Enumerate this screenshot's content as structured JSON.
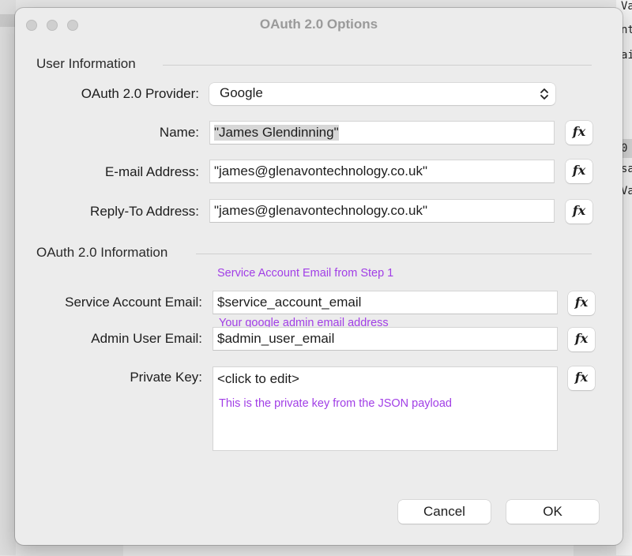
{
  "window": {
    "title": "OAuth 2.0 Options"
  },
  "sections": {
    "user_information": "User Information",
    "oauth_information": "OAuth 2.0 Information"
  },
  "fields": {
    "provider": {
      "label": "OAuth 2.0 Provider:",
      "value": "Google"
    },
    "name": {
      "label": "Name:",
      "value": "\"James Glendinning\""
    },
    "email": {
      "label": "E-mail Address:",
      "value": "\"james@glenavontechnology.co.uk\""
    },
    "reply_to": {
      "label": "Reply-To Address:",
      "value": "\"james@glenavontechnology.co.uk\""
    },
    "service_account": {
      "label": "Service Account Email:",
      "value": "$service_account_email",
      "hint": "Service Account Email from Step 1"
    },
    "admin_user": {
      "label": "Admin User Email:",
      "value": "$admin_user_email",
      "hint": "Your google admin email address"
    },
    "private_key": {
      "label": "Private Key:",
      "value": "<click to edit>",
      "hint": "This is the private key from the JSON payload"
    }
  },
  "fx_label": "fx",
  "buttons": {
    "cancel": "Cancel",
    "ok": "OK"
  },
  "background": {
    "right_fragments": [
      "Va",
      "nt",
      "ai",
      "0",
      "sa",
      "Va"
    ]
  },
  "colors": {
    "hint": "#a13ee6",
    "dialog_bg": "#ececec"
  }
}
